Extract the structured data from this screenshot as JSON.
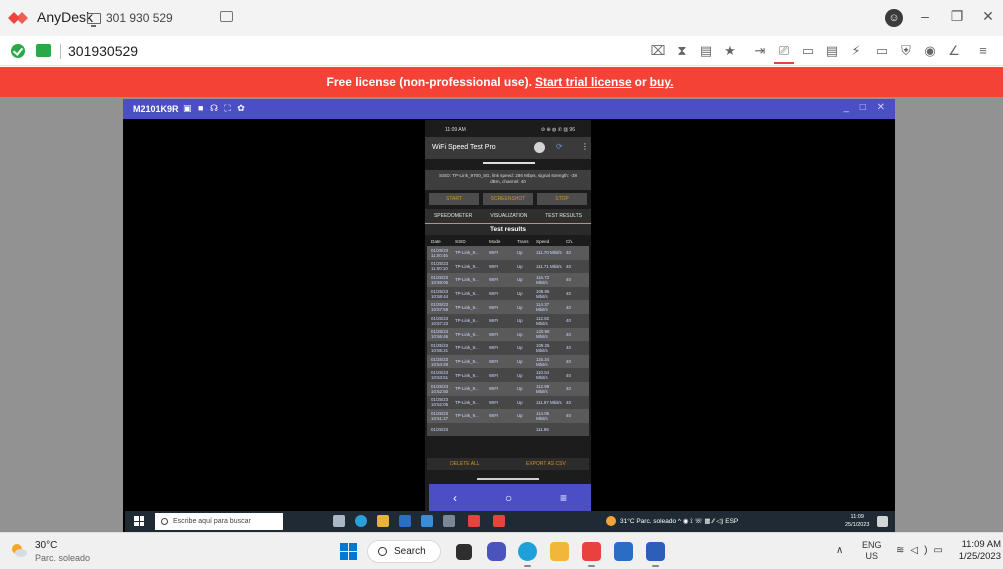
{
  "app": {
    "name": "AnyDesk",
    "tab_label": "301 930 529",
    "address_value": "301930529",
    "brand_color": "#ef443b"
  },
  "banner": {
    "prefix": "Free license (non-professional use).",
    "trial_link": "Start trial license",
    "middle": "or",
    "buy_link": "buy."
  },
  "remote": {
    "window_title": "M2101K9R",
    "titlebar_icons": "▣ ■ ☊ ⛶ ✿",
    "window_controls": "_ □ ✕",
    "phone": {
      "status_time": "11:09 AM",
      "status_right": "⊘ ⊕ ◍ ✆ ▥ 96",
      "app_title": "WiFi Speed Test Pro",
      "ssid_info": "SSID: TP-Link_9700_5G, link speed: 286 Mbps, signal strength: -38 dBm, channel: 40",
      "buttons": {
        "start": "START",
        "screenshot": "SCREENSHOT",
        "stop": "STOP"
      },
      "tabs": {
        "speedometer": "SPEEDOMETER",
        "visualization": "VISUALIZATION",
        "test_results": "TEST RESULTS"
      },
      "results_title": "Test results",
      "columns": [
        "Date",
        "SSID",
        "Mode",
        "Trans",
        "Speed",
        "Ch."
      ],
      "rows": [
        [
          "01/25/23 11:00:45",
          "TP-Link_9...",
          "WIFI",
          "Up",
          "111.70 Mbit/s",
          "40"
        ],
        [
          "01/25/23 11:00:10",
          "TP-Link_9...",
          "WIFI",
          "Up",
          "111.71 Mbit/s",
          "40"
        ],
        [
          "01/25/23 10:59:06",
          "TP-Link_9...",
          "WIFI",
          "Up",
          "116.72 Mbit/s",
          "40"
        ],
        [
          "01/25/23 10:58:44",
          "TP-Link_9...",
          "WIFI",
          "Up",
          "108.85 Mbit/s",
          "40"
        ],
        [
          "01/25/23 10:57:59",
          "TP-Link_9...",
          "WIFI",
          "Up",
          "114.37 Mbit/s",
          "40"
        ],
        [
          "01/25/23 10:57:23",
          "TP-Link_9...",
          "WIFI",
          "Up",
          "112.82 Mbit/s",
          "40"
        ],
        [
          "01/25/23 10:56:46",
          "TP-Link_9...",
          "WIFI",
          "Up",
          "120.90 Mbit/s",
          "40"
        ],
        [
          "01/25/23 10:55:21",
          "TP-Link_9...",
          "WIFI",
          "Up",
          "109.25 Mbit/s",
          "40"
        ],
        [
          "01/25/23 10:54:29",
          "TP-Link_9...",
          "WIFI",
          "Up",
          "115.34 Mbit/s",
          "40"
        ],
        [
          "01/25/23 10:53:51",
          "TP-Link_9...",
          "WIFI",
          "Up",
          "110.54 Mbit/s",
          "40"
        ],
        [
          "01/25/23 10:52:50",
          "TP-Link_9...",
          "WIFI",
          "Up",
          "112.98 Mbit/s",
          "40"
        ],
        [
          "01/25/23 10:52:05",
          "TP-Link_9...",
          "WIFI",
          "Up",
          "111.87 Mbit/s",
          "40"
        ],
        [
          "01/25/23 10:51:27",
          "TP-Link_9...",
          "WIFI",
          "Up",
          "114.05 Mbit/s",
          "40"
        ],
        [
          "01/25/23",
          "",
          "",
          "",
          "111.96",
          ""
        ]
      ],
      "bottom_buttons": {
        "delete_all": "DELETE ALL",
        "export_csv": "EXPORT AS CSV"
      },
      "nav": {
        "back": "‹",
        "home": "○",
        "menu": "≡"
      }
    },
    "taskbar": {
      "search_placeholder": "Escribe aquí para buscar",
      "tray_text": "31°C  Parc. soleado  ^  ◉  ⟟  ☏  ▦  ⁄⁄  ◁)  ESP",
      "clock_time": "11:09",
      "clock_date": "25/1/2023"
    }
  },
  "taskbar": {
    "weather_temp": "30°C",
    "weather_desc": "Parc. soleado",
    "search_label": "Search",
    "lang_top": "ENG",
    "lang_bottom": "US",
    "clock_time": "11:09 AM",
    "clock_date": "1/25/2023"
  }
}
